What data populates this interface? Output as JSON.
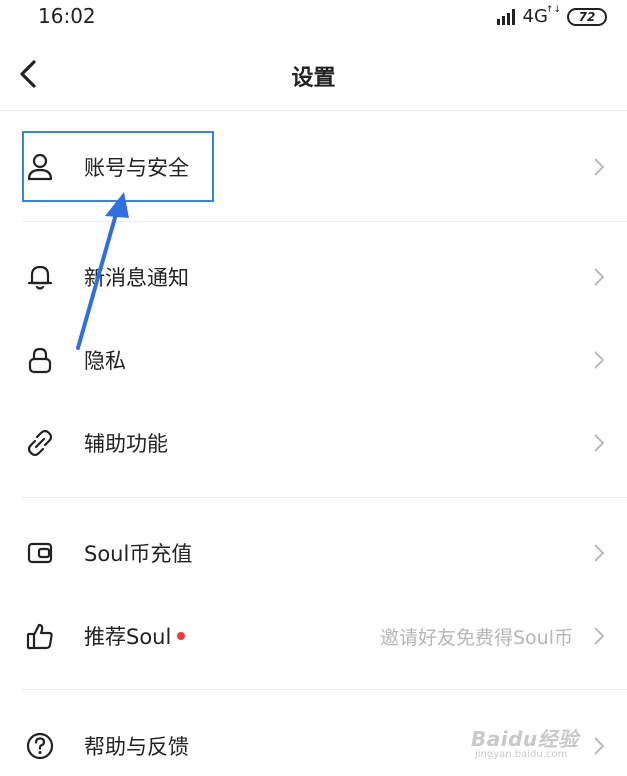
{
  "status_bar": {
    "time": "16:02",
    "network": "4G",
    "network_sup": "↑↓",
    "battery": "72"
  },
  "header": {
    "title": "设置"
  },
  "menu": {
    "items": [
      {
        "label": "账号与安全",
        "icon": "user-icon"
      },
      {
        "label": "新消息通知",
        "icon": "bell-icon"
      },
      {
        "label": "隐私",
        "icon": "lock-icon"
      },
      {
        "label": "辅助功能",
        "icon": "link-icon"
      },
      {
        "label": "Soul币充值",
        "icon": "wallet-icon"
      },
      {
        "label": "推荐Soul",
        "icon": "thumbs-up-icon",
        "hint": "邀请好友免费得Soul币",
        "badge": "red-dot"
      },
      {
        "label": "帮助与反馈",
        "icon": "help-circle-icon"
      }
    ]
  },
  "watermark": {
    "main": "Baidu经验",
    "sub": "jingyan.baidu.com"
  },
  "colors": {
    "highlight": "#3c82d8",
    "arrow": "#2f6fe0",
    "badge": "#f23b3b",
    "hint_text": "#b6b6b6"
  }
}
